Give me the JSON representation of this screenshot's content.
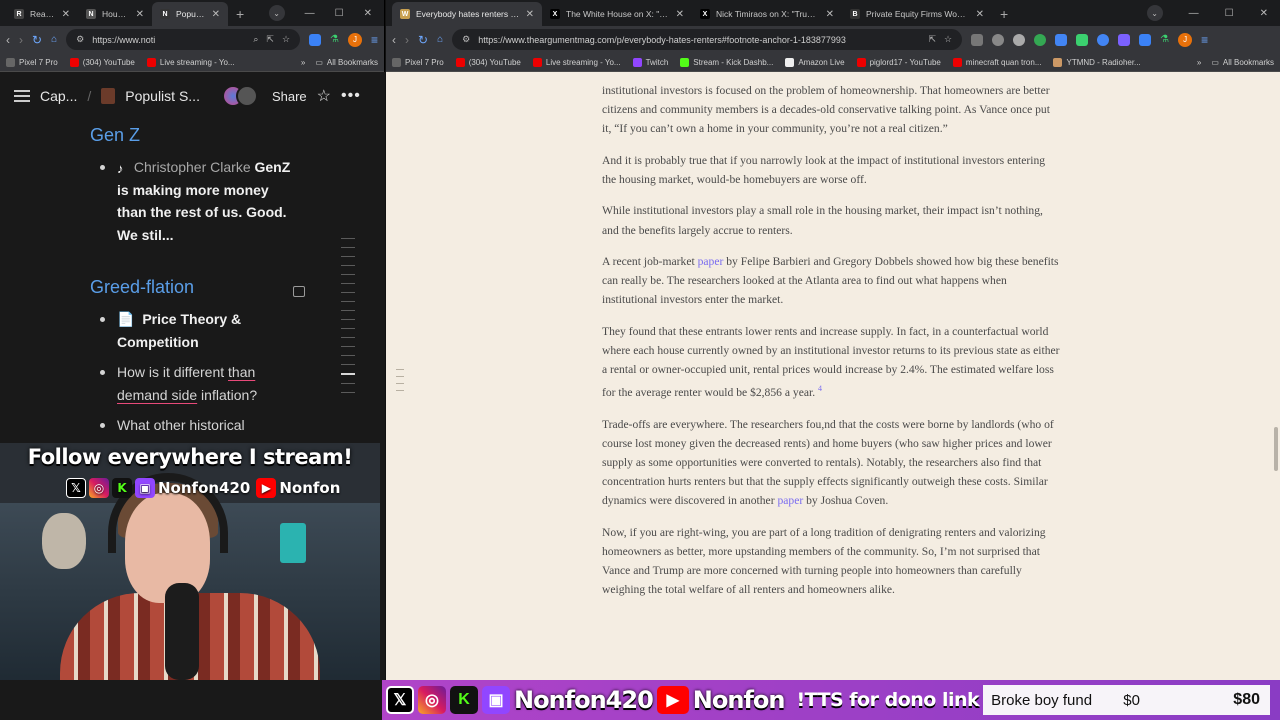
{
  "left_browser": {
    "tabs": [
      {
        "title": "React to",
        "fav_color": "#444"
      },
      {
        "title": "Housing",
        "fav_color": "#555"
      },
      {
        "title": "Populist",
        "fav_color": "#333",
        "active": true
      }
    ],
    "url": "https://www.noti",
    "bookmarks": [
      {
        "label": "Pixel 7 Pro",
        "color": "#666"
      },
      {
        "label": "(304) YouTube",
        "color": "#e00"
      },
      {
        "label": "Live streaming - Yo...",
        "color": "#e00"
      }
    ],
    "all_bookmarks": "All Bookmarks"
  },
  "notion": {
    "breadcrumb_1": "Cap...",
    "breadcrumb_sep": "/",
    "breadcrumb_2": "Populist S...",
    "share": "Share",
    "sections": {
      "genz": {
        "heading": "Gen Z",
        "author": "Christopher Clarke",
        "quote": "GenZ is making more money than the rest of us. Good. We stil..."
      },
      "greed": {
        "heading": "Greed-flation",
        "item1": "Price Theory & Competition",
        "item2_pre": "How is it different ",
        "item2_ul1": "than",
        "item2_ul2": "demand side",
        "item2_post": " inflation?",
        "item3": "What other historical"
      }
    }
  },
  "overlay": {
    "follow": "Follow everywhere I stream!",
    "handle": "Nonfon420",
    "yt_handle": "Nonfon"
  },
  "right_browser": {
    "tabs": [
      {
        "title": "Everybody hates renters - by Je",
        "fav_color": "#c8a050",
        "fav": "W",
        "active": true
      },
      {
        "title": "The White House on X: \"BREAK",
        "fav_color": "#000",
        "fav": "X"
      },
      {
        "title": "Nick Timiraos on X: \"Trump is c",
        "fav_color": "#000",
        "fav": "X"
      },
      {
        "title": "Private Equity Firms Won't Be I",
        "fav_color": "#333",
        "fav": "B"
      }
    ],
    "url": "https://www.theargumentmag.com/p/everybody-hates-renters#footnote-anchor-1-183877993",
    "bookmarks": [
      {
        "label": "Pixel 7 Pro",
        "color": "#666"
      },
      {
        "label": "(304) YouTube",
        "color": "#e00"
      },
      {
        "label": "Live streaming - Yo...",
        "color": "#e00"
      },
      {
        "label": "Twitch",
        "color": "#9146ff"
      },
      {
        "label": "Stream - Kick Dashb...",
        "color": "#53fc18"
      },
      {
        "label": "Amazon Live",
        "color": "#eee"
      },
      {
        "label": "piglord17 - YouTube",
        "color": "#e00"
      },
      {
        "label": "minecraft quan tron...",
        "color": "#e00"
      },
      {
        "label": "YTMND - Radioher...",
        "color": "#c96"
      }
    ],
    "all_bookmarks": "All Bookmarks"
  },
  "article": {
    "p0_partial": "institutional investors is focused on the problem of homeownership. That homeowners are better citizens and community members is a decades-old conservative talking point. As Vance once put it, “If you can’t own a home in your community, you’re not a real citizen.”",
    "p1": "And it is probably true that if you narrowly look at the impact of institutional investors entering the housing market, would-be homebuyers are worse off.",
    "p2": "While institutional investors play a small role in the housing market, their impact isn’t nothing, and the benefits largely accrue to renters.",
    "p3_a": "A recent job-market ",
    "p3_link": "paper",
    "p3_b": " by Felipe Barbieri and Gregory Dobbels showed how big these benefits can really be. The researchers looked at the Atlanta area to find out what happens when institutional investors enter the market.",
    "p4": "They found that these entrants lower rents and increase supply. In fact, in a counterfactual world where each house currently owned by an institutional investor returns to its previous state as either a rental or owner-occupied unit, rental prices would increase by 2.4%. The estimated welfare loss for the average renter would be $2,856 a year. ",
    "p4_fn": "4",
    "p5_a": "Trade-offs are everywhere. The researchers fou,nd that the costs were borne by landlords (who of course lost money given the decreased rents) and home buyers (who saw higher prices and lower supply as some opportunities were converted to rentals). Notably, the researchers also find that concentration hurts renters but that the supply effects significantly outweigh these costs. Similar dynamics were discovered in another ",
    "p5_link": "paper",
    "p5_b": " by Joshua Coven.",
    "p6": "Now, if you are right-wing, you are part of a long tradition of denigrating renters and valorizing homeowners as better, more upstanding members of the community. So, I’m not surprised that Vance and Trump are more concerned with turning people into homeowners than carefully weighing the total welfare of all renters and homeowners alike."
  },
  "bottombar": {
    "handle": "Nonfon420",
    "yt": "Nonfon",
    "tts": "!TTS for dono link",
    "fund_name": "Broke boy fund",
    "fund_current": "$0",
    "fund_goal": "$80"
  },
  "colors": {
    "notion_heading": "#5a9ee8",
    "link": "#7a6cf0",
    "twitch": "#9146ff",
    "kick": "#53fc18",
    "youtube": "#ff0000"
  }
}
